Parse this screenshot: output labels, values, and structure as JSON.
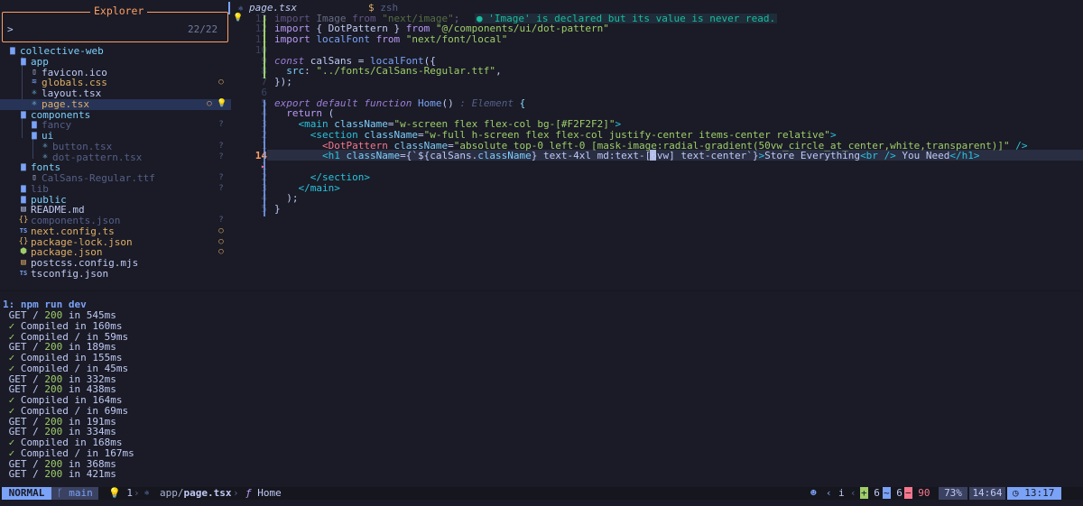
{
  "explorer": {
    "title": "Explorer",
    "prompt": ">",
    "count": "22/22",
    "items": [
      {
        "name": "collective-web",
        "icon": "folder-open-icon",
        "color": "#7dcfff",
        "status": ""
      },
      {
        "name": "app",
        "icon": "folder-open-icon",
        "color": "#7dcfff",
        "status": ""
      },
      {
        "name": "favicon.ico",
        "icon": "file-icon",
        "color": "#c0caf5",
        "status": ""
      },
      {
        "name": "globals.css",
        "icon": "css-icon",
        "color": "#e0af68",
        "status": "○"
      },
      {
        "name": "layout.tsx",
        "icon": "react-icon",
        "color": "#c0caf5",
        "status": ""
      },
      {
        "name": "page.tsx",
        "icon": "react-icon",
        "color": "#e0af68",
        "status": "○"
      },
      {
        "name": "components",
        "icon": "folder-open-icon",
        "color": "#7dcfff",
        "status": ""
      },
      {
        "name": "fancy",
        "icon": "folder-icon",
        "color": "#565f89",
        "status": "?"
      },
      {
        "name": "ui",
        "icon": "folder-open-icon",
        "color": "#7dcfff",
        "status": ""
      },
      {
        "name": "button.tsx",
        "icon": "react-icon",
        "color": "#565f89",
        "status": "?"
      },
      {
        "name": "dot-pattern.tsx",
        "icon": "react-icon",
        "color": "#565f89",
        "status": "?"
      },
      {
        "name": "fonts",
        "icon": "folder-open-icon",
        "color": "#7dcfff",
        "status": ""
      },
      {
        "name": "CalSans-Regular.ttf",
        "icon": "file-icon",
        "color": "#565f89",
        "status": "?"
      },
      {
        "name": "lib",
        "icon": "folder-icon",
        "color": "#565f89",
        "status": "?"
      },
      {
        "name": "public",
        "icon": "folder-icon",
        "color": "#7dcfff",
        "status": ""
      },
      {
        "name": "README.md",
        "icon": "markdown-icon",
        "color": "#c0caf5",
        "status": ""
      },
      {
        "name": "components.json",
        "icon": "json-icon",
        "color": "#565f89",
        "status": "?"
      },
      {
        "name": "next.config.ts",
        "icon": "ts-icon",
        "color": "#e0af68",
        "status": "○"
      },
      {
        "name": "package-lock.json",
        "icon": "json-icon",
        "color": "#e0af68",
        "status": "○"
      },
      {
        "name": "package.json",
        "icon": "node-icon",
        "color": "#e0af68",
        "status": "○"
      },
      {
        "name": "postcss.config.mjs",
        "icon": "js-icon",
        "color": "#c0caf5",
        "status": ""
      },
      {
        "name": "tsconfig.json",
        "icon": "ts-icon",
        "color": "#c0caf5",
        "status": ""
      }
    ]
  },
  "tabs": [
    {
      "label": "page.tsx",
      "icon": "react-icon",
      "active": true
    },
    {
      "label": "zsh",
      "icon": "terminal-icon",
      "active": false
    }
  ],
  "editor": {
    "diagnostic": "● 'Image' is declared but its value is never read.",
    "inlay_return": ": Element",
    "lines": [
      {
        "num": "13",
        "text": "import Image from \"next/image\";"
      },
      {
        "num": "12",
        "text": "import { DotPattern } from \"@/components/ui/dot-pattern\""
      },
      {
        "num": "11",
        "text": "import localFont from \"next/font/local\""
      },
      {
        "num": "10",
        "text": ""
      },
      {
        "num": "9",
        "text": "const calSans = localFont({"
      },
      {
        "num": "8",
        "text": "  src: \"../fonts/CalSans-Regular.ttf\","
      },
      {
        "num": "7",
        "text": "});"
      },
      {
        "num": "6",
        "text": ""
      },
      {
        "num": "5",
        "text": "export default function Home()"
      },
      {
        "num": "4",
        "text": "  return ("
      },
      {
        "num": "3",
        "text": "    <main className=\"w-screen flex flex-col bg-[#F2F2F2]\">"
      },
      {
        "num": "2",
        "text": "      <section className=\"w-full h-screen flex flex-col justify-center items-center relative\">"
      },
      {
        "num": "1",
        "text": "        <DotPattern className=\"absolute top-0 left-0 [mask-image:radial-gradient(50vw_circle_at_center,white,transparent)]\" />"
      },
      {
        "num": "14",
        "text": "        <h1 className={`${calSans.className} text-4xl md:text-[6vw] text-center`}>Store Everything<br /> You Need</h1>"
      },
      {
        "num": "1",
        "text": ""
      },
      {
        "num": "2",
        "text": "      </section>"
      },
      {
        "num": "3",
        "text": "    </main>"
      },
      {
        "num": "4",
        "text": "  );"
      },
      {
        "num": "5",
        "text": "}"
      }
    ]
  },
  "terminal": {
    "header": "1: npm run dev",
    "lines": [
      " GET / 200 in 545ms",
      " ✓ Compiled in 160ms",
      " ✓ Compiled / in 59ms",
      " GET / 200 in 189ms",
      " ✓ Compiled in 155ms",
      " ✓ Compiled / in 45ms",
      " GET / 200 in 332ms",
      " GET / 200 in 438ms",
      " ✓ Compiled in 164ms",
      " ✓ Compiled / in 69ms",
      " GET / 200 in 191ms",
      " GET / 200 in 334ms",
      " ✓ Compiled in 168ms",
      " ✓ Compiled / in 167ms",
      " GET / 200 in 368ms",
      " GET / 200 in 421ms"
    ]
  },
  "statusbar": {
    "mode": "NORMAL",
    "branch": "main",
    "lightbulb_count": "1",
    "crumb_dir": "app/",
    "crumb_file": "page.tsx",
    "crumb_symbol": "Home",
    "nav_left": "‹",
    "info": "i",
    "added": "6",
    "changed": "6",
    "removed": "90",
    "percent": "73%",
    "position": "14:64",
    "clock": "13:17"
  }
}
